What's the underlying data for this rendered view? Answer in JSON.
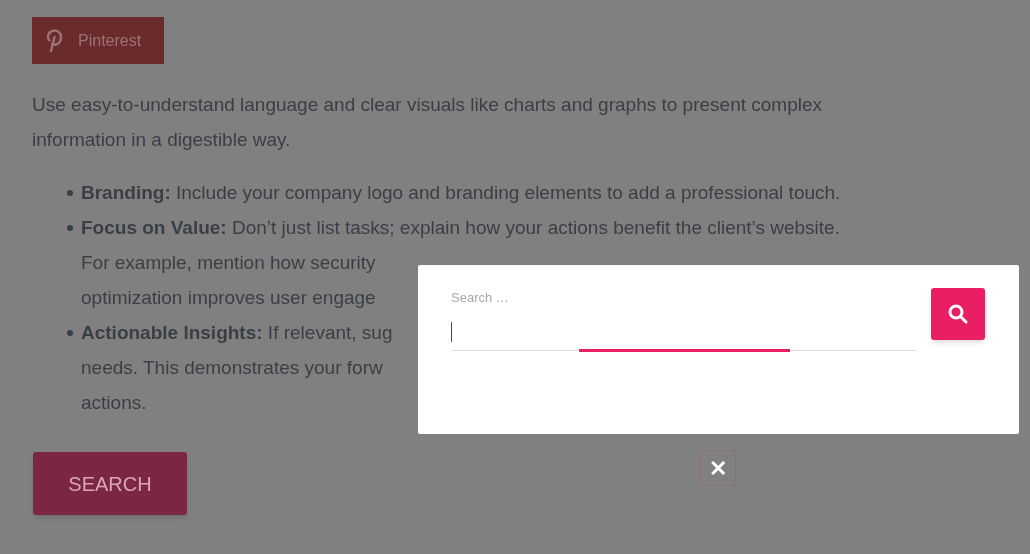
{
  "share_button": {
    "label": "Pinterest"
  },
  "intro": [
    "Use easy-to-understand language and clear visuals like charts and graphs to present complex",
    "information in a digestible way."
  ],
  "bullets": [
    {
      "lines": [
        "**Branding:** Include your company logo and branding elements to add a professional touch."
      ]
    },
    {
      "lines": [
        "**Focus on Value:** Don’t just list tasks; explain how your actions benefit the client’s website.",
        "For example, mention how security",
        "optimization improves user engage"
      ]
    },
    {
      "lines": [
        "**Actionable Insights:** If relevant, sug",
        "needs. This demonstrates your forw",
        "actions."
      ]
    }
  ],
  "search_button": {
    "label": "SEARCH"
  },
  "search_dialog": {
    "label": "Search …",
    "focused": true,
    "close": "✕"
  }
}
